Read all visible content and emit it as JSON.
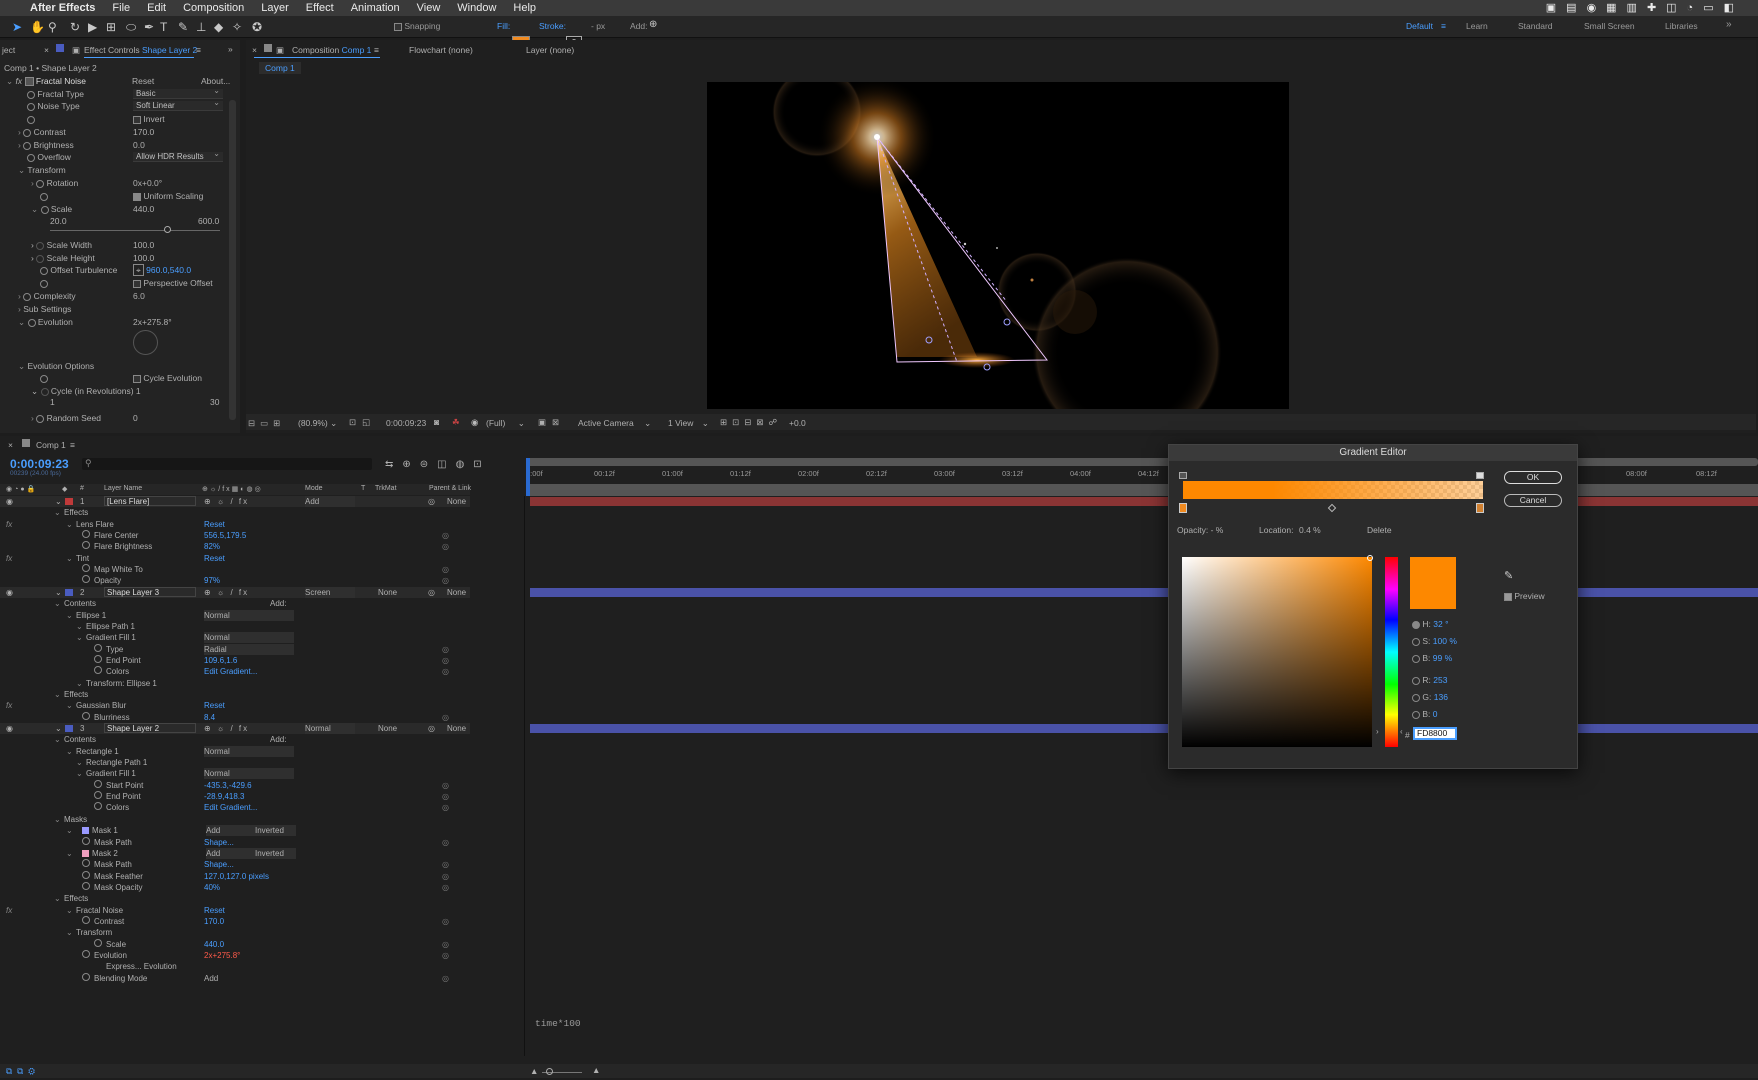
{
  "menubar": {
    "app": "After Effects",
    "items": [
      "File",
      "Edit",
      "Composition",
      "Layer",
      "Effect",
      "Animation",
      "View",
      "Window",
      "Help"
    ]
  },
  "toolbar": {
    "snapping": "Snapping",
    "fill": "Fill:",
    "stroke": "Stroke:",
    "stroke_value": "?",
    "px": "- px",
    "add": "Add:",
    "workspaces": [
      "Default",
      "Learn",
      "Standard",
      "Small Screen",
      "Libraries"
    ]
  },
  "project_tab": "ject",
  "effect_controls": {
    "tab": "Effect Controls",
    "tab_layer": "Shape Layer 2",
    "path": "Comp 1 • Shape Layer 2",
    "effect": "Fractal Noise",
    "reset": "Reset",
    "about": "About...",
    "fractal_type": {
      "label": "Fractal Type",
      "value": "Basic"
    },
    "noise_type": {
      "label": "Noise Type",
      "value": "Soft Linear"
    },
    "invert": "Invert",
    "contrast": {
      "label": "Contrast",
      "value": "170.0"
    },
    "brightness": {
      "label": "Brightness",
      "value": "0.0"
    },
    "overflow": {
      "label": "Overflow",
      "value": "Allow HDR Results"
    },
    "transform": "Transform",
    "rotation": {
      "label": "Rotation",
      "value": "0x+0.0°"
    },
    "uniform_scaling": "Uniform Scaling",
    "scale": {
      "label": "Scale",
      "value": "440.0",
      "min": "20.0",
      "max": "600.0"
    },
    "scale_width": {
      "label": "Scale Width",
      "value": "100.0"
    },
    "scale_height": {
      "label": "Scale Height",
      "value": "100.0"
    },
    "offset_turbulence": {
      "label": "Offset Turbulence",
      "value": "960.0,540.0"
    },
    "perspective_offset": "Perspective Offset",
    "complexity": {
      "label": "Complexity",
      "value": "6.0"
    },
    "sub_settings": "Sub Settings",
    "evolution": {
      "label": "Evolution",
      "value": "2x+275.8°"
    },
    "evolution_options": "Evolution Options",
    "cycle_evolution": "Cycle Evolution",
    "cycle_revolutions": {
      "label": "Cycle (in Revolutions)",
      "value": "1",
      "min": "1",
      "max": "30"
    },
    "random_seed": {
      "label": "Random Seed",
      "value": "0"
    }
  },
  "comp_viewer": {
    "tab": "Composition",
    "tab_comp": "Comp 1",
    "flowchart": "Flowchart (none)",
    "layer": "Layer (none)",
    "crumb": "Comp 1",
    "zoom": "(80.9%)",
    "time": "0:00:09:23",
    "resolution": "(Full)",
    "camera": "Active Camera",
    "views": "1 View",
    "exposure": "+0.0"
  },
  "timeline": {
    "comp": "Comp 1",
    "timecode": "0:00:09:23",
    "frames": "00239 (24.00 fps)",
    "columns": {
      "num": "#",
      "layer_name": "Layer Name",
      "mode": "Mode",
      "t": "T",
      "trkmat": "TrkMat",
      "parent": "Parent & Link"
    },
    "ruler": [
      "0:00f",
      "00:12f",
      "01:00f",
      "01:12f",
      "02:00f",
      "02:12f",
      "03:00f",
      "03:12f",
      "04:00f",
      "04:12f",
      "08:00f",
      "08:12f"
    ],
    "rows": [
      {
        "kind": "layer",
        "num": "1",
        "name": "[Lens Flare]",
        "mode": "Add",
        "parent": "None",
        "color": "#c03a3a"
      },
      {
        "kind": "group",
        "name": "Effects"
      },
      {
        "kind": "effect",
        "name": "Lens Flare",
        "value": "Reset"
      },
      {
        "kind": "prop",
        "name": "Flare Center",
        "value": "556.5,179.5"
      },
      {
        "kind": "prop",
        "name": "Flare Brightness",
        "value": "82%"
      },
      {
        "kind": "effect",
        "name": "Tint",
        "value": "Reset"
      },
      {
        "kind": "prop",
        "name": "Map White To",
        "value": ""
      },
      {
        "kind": "prop",
        "name": "Opacity",
        "value": "97%"
      },
      {
        "kind": "layer",
        "num": "2",
        "name": "Shape Layer 3",
        "mode": "Screen",
        "trkmat": "None",
        "parent": "None",
        "color": "#4a5cc0"
      },
      {
        "kind": "group",
        "name": "Contents",
        "value": "Add:"
      },
      {
        "kind": "sub",
        "name": "Ellipse 1",
        "value": "Normal"
      },
      {
        "kind": "sub2",
        "name": "Ellipse Path 1",
        "value": ""
      },
      {
        "kind": "sub2",
        "name": "Gradient Fill 1",
        "value": "Normal"
      },
      {
        "kind": "prop2",
        "name": "Type",
        "value": "Radial"
      },
      {
        "kind": "prop2",
        "name": "End Point",
        "value": "109.6,1.6"
      },
      {
        "kind": "prop2",
        "name": "Colors",
        "value": "Edit Gradient..."
      },
      {
        "kind": "sub2",
        "name": "Transform: Ellipse 1",
        "value": ""
      },
      {
        "kind": "group",
        "name": "Effects"
      },
      {
        "kind": "effect",
        "name": "Gaussian Blur",
        "value": "Reset"
      },
      {
        "kind": "prop",
        "name": "Blurriness",
        "value": "8.4"
      },
      {
        "kind": "layer",
        "num": "3",
        "name": "Shape Layer 2",
        "mode": "Normal",
        "trkmat": "None",
        "parent": "None",
        "color": "#4a5cc0"
      },
      {
        "kind": "group",
        "name": "Contents",
        "value": "Add:"
      },
      {
        "kind": "sub",
        "name": "Rectangle 1",
        "value": "Normal"
      },
      {
        "kind": "sub2",
        "name": "Rectangle Path 1",
        "value": ""
      },
      {
        "kind": "sub2",
        "name": "Gradient Fill 1",
        "value": "Normal"
      },
      {
        "kind": "prop2",
        "name": "Start Point",
        "value": "-435.3,-429.6"
      },
      {
        "kind": "prop2",
        "name": "End Point",
        "value": "-28.9,418.3"
      },
      {
        "kind": "prop2",
        "name": "Colors",
        "value": "Edit Gradient..."
      },
      {
        "kind": "group",
        "name": "Masks"
      },
      {
        "kind": "mask",
        "name": "Mask 1",
        "value": "Add",
        "extra": "Inverted"
      },
      {
        "kind": "prop",
        "name": "Mask Path",
        "value": "Shape..."
      },
      {
        "kind": "mask",
        "name": "Mask 2",
        "value": "Add",
        "extra": "Inverted"
      },
      {
        "kind": "prop",
        "name": "Mask Path",
        "value": "Shape..."
      },
      {
        "kind": "prop",
        "name": "Mask Feather",
        "value": "127.0,127.0 pixels"
      },
      {
        "kind": "prop",
        "name": "Mask Opacity",
        "value": "40%"
      },
      {
        "kind": "group",
        "name": "Effects"
      },
      {
        "kind": "effect",
        "name": "Fractal Noise",
        "value": "Reset"
      },
      {
        "kind": "prop",
        "name": "Contrast",
        "value": "170.0"
      },
      {
        "kind": "sub",
        "name": "Transform",
        "value": ""
      },
      {
        "kind": "prop2",
        "name": "Scale",
        "value": "440.0"
      },
      {
        "kind": "prop",
        "name": "Evolution",
        "value": "2x+275.8°"
      },
      {
        "kind": "expr",
        "name": "Express... Evolution",
        "value": ""
      },
      {
        "kind": "prop",
        "name": "Blending Mode",
        "value": "Add"
      }
    ],
    "expression": "time*100"
  },
  "gradient_editor": {
    "title": "Gradient Editor",
    "ok": "OK",
    "cancel": "Cancel",
    "opacity_label": "Opacity:",
    "opacity_value": "- %",
    "location_label": "Location:",
    "location_value": "0.4 %",
    "delete": "Delete",
    "preview": "Preview",
    "h": {
      "label": "H:",
      "value": "32 °"
    },
    "s": {
      "label": "S:",
      "value": "100 %"
    },
    "b": {
      "label": "B:",
      "value": "99 %"
    },
    "r": {
      "label": "R:",
      "value": "253"
    },
    "g": {
      "label": "G:",
      "value": "136"
    },
    "bl": {
      "label": "B:",
      "value": "0"
    },
    "hex_label": "#",
    "hex": "FD8800",
    "color": "#fd8800"
  }
}
